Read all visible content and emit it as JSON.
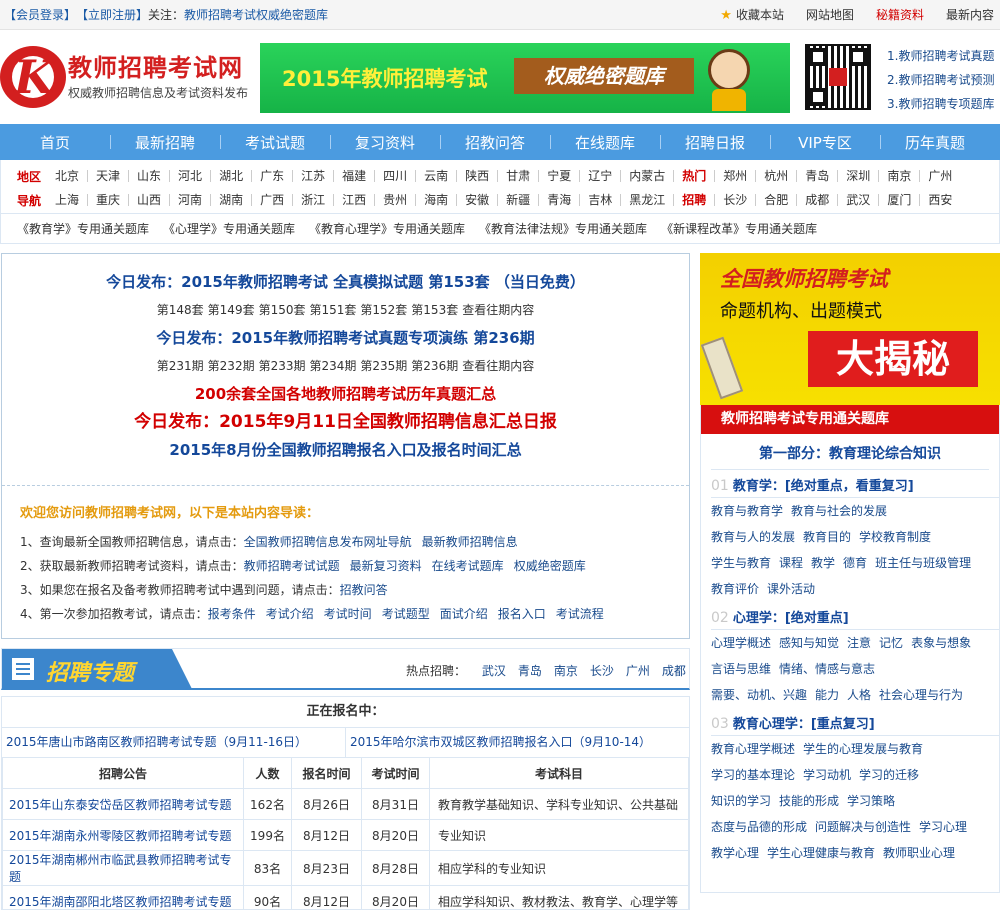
{
  "topbar": {
    "login": "【会员登录】",
    "register": "【立即注册】",
    "follow_label": "关注：",
    "follow_link": "教师招聘考试权威绝密题库",
    "favorite": "收藏本站",
    "sitemap": "网站地图",
    "secret": "秘籍资料",
    "latest": "最新内容"
  },
  "header": {
    "logo_title": "教师招聘考试网",
    "logo_sub": "权威教师招聘信息及考试资料发布",
    "banner_year": "2015年教师招聘考试",
    "banner_box": "权威绝密题库",
    "links": [
      "1.教师招聘考试真题",
      "2.教师招聘考试预测",
      "3.教师招聘专项题库"
    ]
  },
  "nav": [
    "首页",
    "最新招聘",
    "考试试题",
    "复习资料",
    "招教问答",
    "在线题库",
    "招聘日报",
    "VIP专区",
    "历年真题"
  ],
  "region": {
    "label1": "地区",
    "label2": "导航",
    "row1": [
      "北京",
      "天津",
      "山东",
      "河北",
      "湖北",
      "广东",
      "江苏",
      "福建",
      "四川",
      "云南",
      "陕西",
      "甘肃",
      "宁夏",
      "辽宁",
      "内蒙古"
    ],
    "hot1": "热门",
    "row1b": [
      "郑州",
      "杭州",
      "青岛",
      "深圳",
      "南京",
      "广州"
    ],
    "row2": [
      "上海",
      "重庆",
      "山西",
      "河南",
      "湖南",
      "广西",
      "浙江",
      "江西",
      "贵州",
      "海南",
      "安徽",
      "新疆",
      "青海",
      "吉林",
      "黑龙江"
    ],
    "hot2": "招聘",
    "row2b": [
      "长沙",
      "合肥",
      "成都",
      "武汉",
      "厦门",
      "西安"
    ]
  },
  "special": [
    "《教育学》专用通关题库",
    "《心理学》专用通关题库",
    "《教育心理学》专用通关题库",
    "《教育法律法规》专用通关题库",
    "《新课程改革》专用通关题库"
  ],
  "announce": {
    "h1": "今日发布：2015年教师招聘考试 全真模拟试题 第153套 （当日免费）",
    "issues1": [
      "第148套",
      "第149套",
      "第150套",
      "第151套",
      "第152套",
      "第153套",
      "查看往期内容"
    ],
    "h2": "今日发布：2015年教师招聘考试真题专项演练 第236期",
    "issues2": [
      "第231期",
      "第232期",
      "第233期",
      "第234期",
      "第235期",
      "第236期",
      "查看往期内容"
    ],
    "h3": "200余套全国各地教师招聘考试历年真题汇总",
    "h4": "今日发布：2015年9月11日全国教师招聘信息汇总日报",
    "h5": "2015年8月份全国教师招聘报名入口及报名时间汇总",
    "welcome": "欢迎您访问教师招聘考试网，以下是本站内容导读：",
    "guide": [
      {
        "n": "1、查询最新全国教师招聘信息，请点击：",
        "links": [
          "全国教师招聘信息发布网址导航",
          "最新教师招聘信息"
        ]
      },
      {
        "n": "2、获取最新教师招聘考试资料，请点击：",
        "links": [
          "教师招聘考试试题",
          "最新复习资料",
          "在线考试题库",
          "权威绝密题库"
        ]
      },
      {
        "n": "3、如果您在报名及备考教师招聘考试中遇到问题，请点击：",
        "links": [
          "招教问答"
        ]
      },
      {
        "n": "4、第一次参加招教考试，请点击：",
        "links": [
          "报考条件",
          "考试介绍",
          "考试时间",
          "考试题型",
          "面试介绍",
          "报名入口",
          "考试流程"
        ]
      }
    ]
  },
  "zt": {
    "title": "招聘专题",
    "hot_label": "热点招聘：",
    "hot": [
      "武汉",
      "青岛",
      "南京",
      "长沙",
      "广州",
      "成都"
    ],
    "caption": "正在报名中：",
    "top_left": "2015年唐山市路南区教师招聘考试专题（9月11-16日）",
    "top_right": "2015年哈尔滨市双城区教师招聘报名入口（9月10-14）",
    "headers": [
      "招聘公告",
      "人数",
      "报名时间",
      "考试时间",
      "考试科目"
    ],
    "rows": [
      [
        "2015年山东泰安岱岳区教师招聘考试专题",
        "162名",
        "8月26日",
        "8月31日",
        "教育教学基础知识、学科专业知识、公共基础"
      ],
      [
        "2015年湖南永州零陵区教师招聘考试专题",
        "199名",
        "8月12日",
        "8月20日",
        "专业知识"
      ],
      [
        "2015年湖南郴州市临武县教师招聘考试专题",
        "83名",
        "8月23日",
        "8月28日",
        "相应学科的专业知识"
      ],
      [
        "2015年湖南邵阳北塔区教师招聘考试专题",
        "90名",
        "8月12日",
        "8月20日",
        "相应学科知识、教材教法、教育学、心理学等"
      ]
    ]
  },
  "right": {
    "ad_t1": "全国教师招聘考试",
    "ad_t2": "命题机构、出题模式",
    "ad_t3": "大揭秘",
    "box_title": "教师招聘考试专用通关题库",
    "part": "第一部分：教育理论综合知识",
    "sections": [
      {
        "num": "01",
        "title": "教育学：[绝对重点，看重复习]",
        "lines": [
          [
            "教育与教育学",
            "教育与社会的发展"
          ],
          [
            "教育与人的发展",
            "教育目的",
            "学校教育制度"
          ],
          [
            "学生与教育",
            "课程",
            "教学",
            "德育",
            "班主任与班级管理"
          ],
          [
            "教育评价",
            "课外活动"
          ]
        ]
      },
      {
        "num": "02",
        "title": "心理学：[绝对重点]",
        "lines": [
          [
            "心理学概述",
            "感知与知觉",
            "注意",
            "记忆",
            "表象与想象"
          ],
          [
            "言语与思维",
            "情绪、情感与意志"
          ],
          [
            "需要、动机、兴趣",
            "能力",
            "人格",
            "社会心理与行为"
          ]
        ]
      },
      {
        "num": "03",
        "title": "教育心理学：[重点复习]",
        "lines": [
          [
            "教育心理学概述",
            "学生的心理发展与教育"
          ],
          [
            "学习的基本理论",
            "学习动机",
            "学习的迁移"
          ],
          [
            "知识的学习",
            "技能的形成",
            "学习策略"
          ],
          [
            "态度与品德的形成",
            "问题解决与创造性",
            "学习心理"
          ],
          [
            "教学心理",
            "学生心理健康与教育",
            "教师职业心理"
          ]
        ]
      }
    ]
  },
  "colors": {
    "brand_red": "#d31f1f",
    "nav_blue": "#4b9be0",
    "link_blue": "#14489a"
  }
}
